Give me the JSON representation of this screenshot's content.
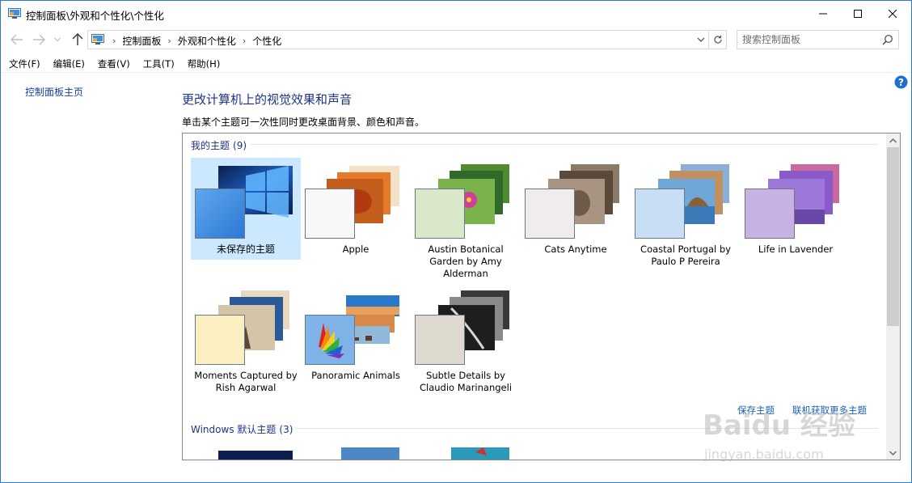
{
  "window": {
    "title": "控制面板\\外观和个性化\\个性化"
  },
  "address": {
    "crumbs": [
      "控制面板",
      "外观和个性化",
      "个性化"
    ],
    "search_placeholder": "搜索控制面板"
  },
  "menu": {
    "items": [
      "文件(F)",
      "编辑(E)",
      "查看(V)",
      "工具(T)",
      "帮助(H)"
    ]
  },
  "left_pane": {
    "home_link": "控制面板主页"
  },
  "main": {
    "title": "更改计算机上的视觉效果和声音",
    "description": "单击某个主题可一次性同时更改桌面背景、颜色和声音。"
  },
  "my_themes": {
    "heading": "我的主题",
    "count": "(9)",
    "items": [
      {
        "name": "未保存的主题",
        "selected": true
      },
      {
        "name": "Apple"
      },
      {
        "name": "Austin Botanical Garden by Amy Alderman"
      },
      {
        "name": "Cats Anytime"
      },
      {
        "name": "Coastal Portugal by Paulo P Pereira"
      },
      {
        "name": "Life in Lavender"
      },
      {
        "name": "Moments Captured by Rish Agarwal"
      },
      {
        "name": "Panoramic Animals"
      },
      {
        "name": "Subtle Details by Claudio Marinangeli"
      }
    ]
  },
  "links": {
    "save_theme": "保存主题",
    "get_more": "联机获取更多主题"
  },
  "windows_themes": {
    "heading": "Windows 默认主题",
    "count": "(3)"
  },
  "watermark": {
    "brand": "Baidu 经验",
    "url": "jingyan.baidu.com"
  },
  "colors": {
    "accent": "#1e3287",
    "link": "#1a5fb4",
    "selection": "#cce8ff",
    "window_border": "#2b79d6"
  }
}
